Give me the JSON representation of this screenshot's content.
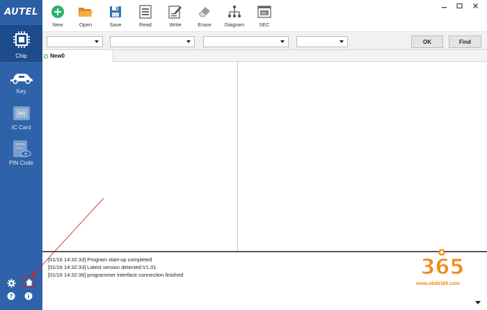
{
  "app": {
    "logo": "AUTEL"
  },
  "sidebar": {
    "items": [
      {
        "label": "Chip",
        "icon": "chip-icon",
        "active": true
      },
      {
        "label": "Key",
        "icon": "car-key-icon"
      },
      {
        "label": "IC Card",
        "icon": "ic-card-icon"
      },
      {
        "label": "PIN Code",
        "icon": "pin-code-icon"
      }
    ],
    "bottom": [
      "gear-icon",
      "home-icon",
      "help-icon",
      "info-icon"
    ]
  },
  "toolbar": {
    "items": [
      {
        "label": "New",
        "icon": "plus-circle-icon"
      },
      {
        "label": "Open",
        "icon": "folder-icon"
      },
      {
        "label": "Save",
        "icon": "floppy-icon"
      },
      {
        "label": "Read",
        "icon": "read-icon"
      },
      {
        "label": "Write",
        "icon": "write-icon"
      },
      {
        "label": "Erase",
        "icon": "eraser-icon"
      },
      {
        "label": "Diagram",
        "icon": "diagram-icon"
      },
      {
        "label": "SEC",
        "icon": "sec-icon"
      }
    ],
    "sec_badge": "SEC"
  },
  "filters": {
    "dropdowns": [
      "",
      "",
      "",
      ""
    ],
    "ok_label": "OK",
    "find_label": "Find"
  },
  "tabs": [
    {
      "label": "New0"
    }
  ],
  "log": {
    "lines": [
      "[01/16 14:32:33] Program start-up completed",
      "[01/16 14:32:33] Latest version detected:V1.01",
      "[01/16 14:32:36] programmer interface connection finished"
    ]
  },
  "watermark": {
    "number": "365",
    "url": "www.obdii365.com"
  },
  "colors": {
    "sidebar": "#2f63a9",
    "sidebar_active": "#1d4b8c",
    "new_icon": "#27b36a",
    "folder_icon": "#f2a23a",
    "save_icon": "#2f6fb5",
    "watermark_orange": "#f28b1a",
    "annotation": "#d32020"
  }
}
